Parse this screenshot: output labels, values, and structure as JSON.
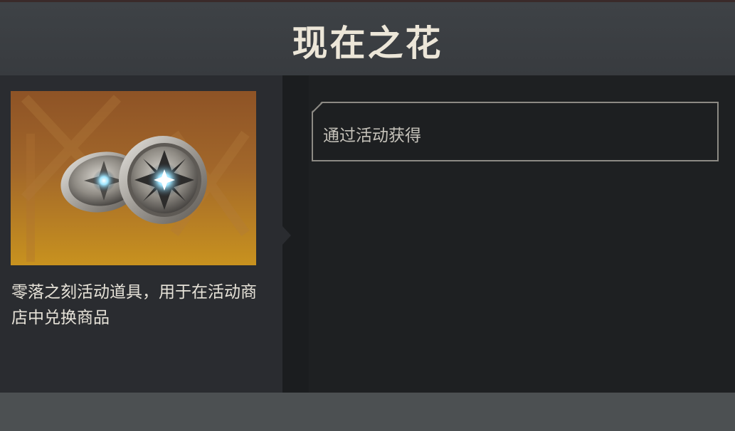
{
  "header": {
    "title": "现在之花"
  },
  "item": {
    "image_icon": "coin-flower-icon",
    "description": "零落之刻活动道具，用于在活动商店中兑换商品"
  },
  "source": {
    "text": "通过活动获得"
  },
  "colors": {
    "header_bg": "#3c4044",
    "title": "#ece6d8",
    "image_bg_top": "#8e5326",
    "image_bg_bottom": "#c8921f",
    "panel_bg": "#2a2c30",
    "right_bg": "#1e2022",
    "bottom_bar": "#4c5052"
  }
}
